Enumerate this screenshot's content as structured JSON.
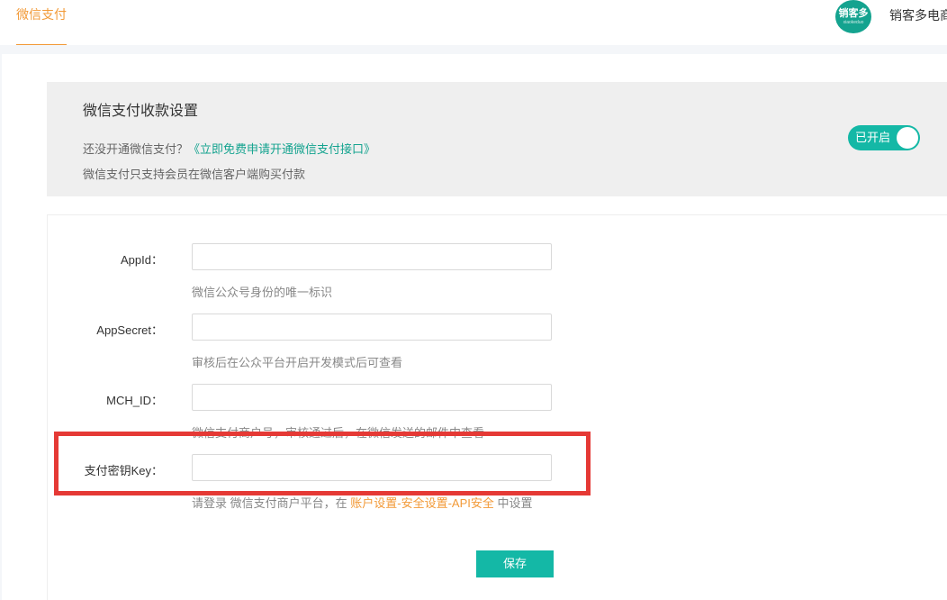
{
  "header": {
    "active_tab": "微信支付",
    "avatar_text": "销客多",
    "avatar_sub": "xiaokeduo",
    "user_name": "销客多电商"
  },
  "settings": {
    "title": "微信支付收款设置",
    "line1_prefix": "还没开通微信支付？",
    "line1_link": "《立即免费申请开通微信支付接口》",
    "line2": "微信支付只支持会员在微信客户端购买付款",
    "toggle_label": "已开启",
    "toggle_on": true
  },
  "form": {
    "fields": [
      {
        "label": "AppId：",
        "value": "",
        "hint": "微信公众号身份的唯一标识"
      },
      {
        "label": "AppSecret：",
        "value": "",
        "hint": "审核后在公众平台开启开发模式后可查看"
      },
      {
        "label": "MCH_ID：",
        "value": "",
        "hint": "微信支付商户号，审核通过后，在微信发送的邮件中查看"
      },
      {
        "label": "支付密钥Key：",
        "value": "",
        "hint_prefix": "请登录 微信支付商户平台，在 ",
        "hint_link": "账户设置-安全设置-API安全",
        "hint_suffix": " 中设置"
      }
    ],
    "save_label": "保存"
  },
  "colors": {
    "accent_teal": "#14b8a6",
    "accent_orange": "#f29a38",
    "highlight_red": "#e53935"
  }
}
